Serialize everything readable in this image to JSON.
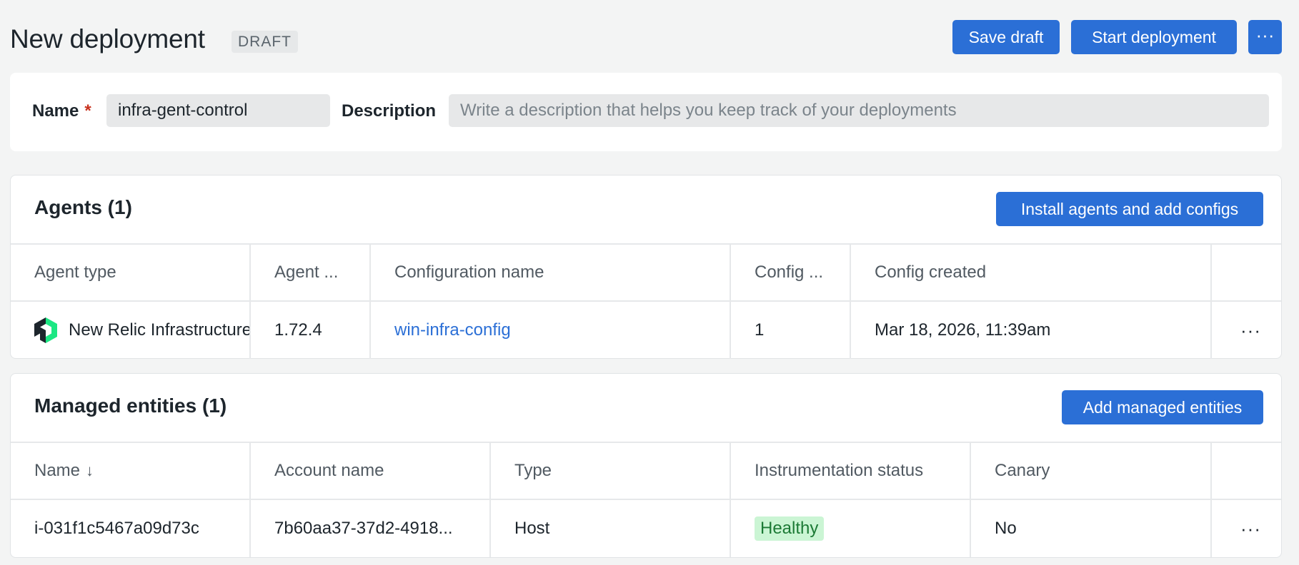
{
  "header": {
    "title": "New deployment",
    "status_badge": "DRAFT",
    "save_draft_label": "Save draft",
    "start_deployment_label": "Start deployment",
    "more_label": "···"
  },
  "form": {
    "name_label": "Name",
    "required_marker": "*",
    "name_value": "infra-gent-control",
    "description_label": "Description",
    "description_placeholder": "Write a description that helps you keep track of your deployments"
  },
  "agents": {
    "title": "Agents (1)",
    "action_label": "Install agents and add configs",
    "columns": [
      "Agent type",
      "Agent ...",
      "Configuration name",
      "Config ...",
      "Config created"
    ],
    "rows": [
      {
        "agent_type": "New Relic Infrastructure",
        "agent_version": "1.72.4",
        "config_name": "win-infra-config",
        "config_version": "1",
        "config_created": "Mar 18, 2026, 11:39am",
        "actions": "···"
      }
    ]
  },
  "entities": {
    "title": "Managed entities (1)",
    "action_label": "Add managed entities",
    "columns": [
      "Name",
      "Account name",
      "Type",
      "Instrumentation status",
      "Canary"
    ],
    "sort_indicator": "↓",
    "rows": [
      {
        "name": "i-031f1c5467a09d73c",
        "account_name": "7b60aa37-37d2-4918...",
        "type": "Host",
        "status": "Healthy",
        "canary": "No",
        "actions": "···"
      }
    ]
  },
  "colors": {
    "primary": "#2b6fd6",
    "healthy_bg": "#cbf5d4",
    "healthy_text": "#1c7a35",
    "required": "#c8321e"
  }
}
